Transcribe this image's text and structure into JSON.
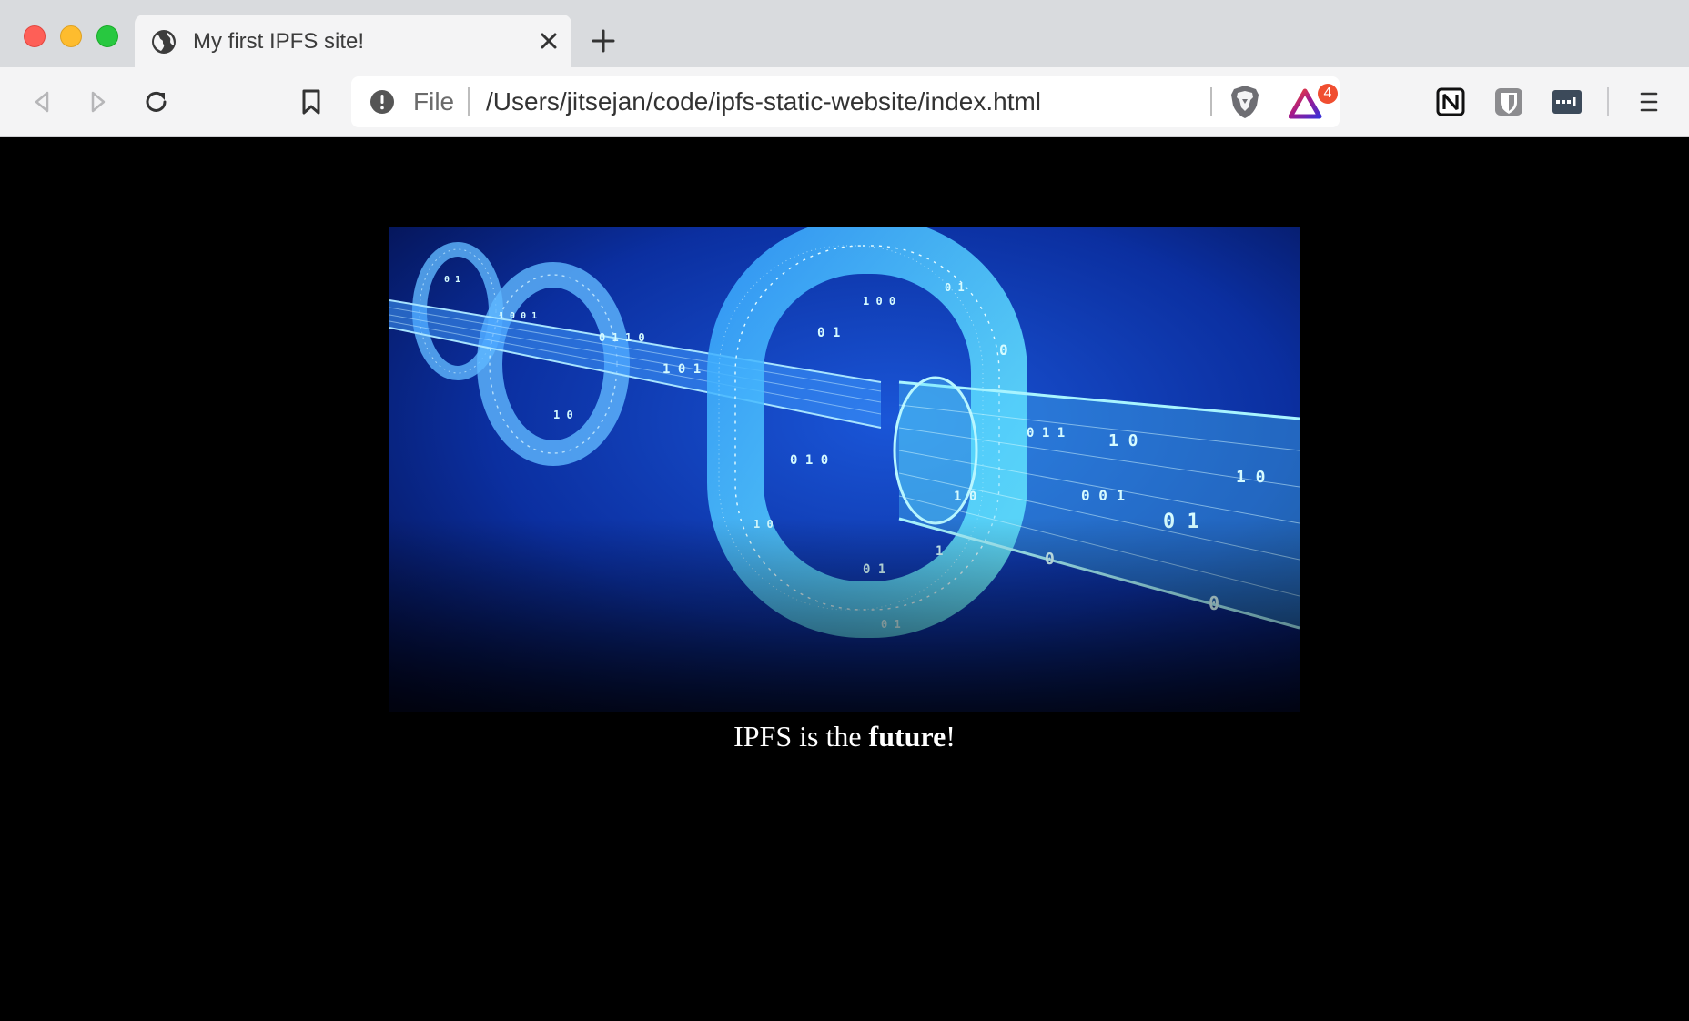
{
  "window": {
    "tab_title": "My first IPFS site!"
  },
  "toolbar": {
    "url_scheme": "File",
    "url": "/Users/jitsejan/code/ipfs-static-website/index.html",
    "rewards_badge": "4"
  },
  "page": {
    "caption_start": "IPFS is the ",
    "caption_bold": "future",
    "caption_end": "!"
  },
  "icons": {
    "globe": "globe-icon",
    "close": "close-icon",
    "new_tab": "plus-icon",
    "back": "back-arrow-icon",
    "forward": "forward-arrow-icon",
    "reload": "reload-icon",
    "bookmark": "bookmark-icon",
    "info": "info-icon",
    "brave_shield": "brave-shield-icon",
    "rewards": "brave-rewards-icon",
    "notion": "notion-icon",
    "bitwarden": "bitwarden-icon",
    "password": "password-manager-icon",
    "menu": "hamburger-menu-icon"
  },
  "colors": {
    "accent_badge": "#f04e30",
    "page_background": "#000000"
  }
}
